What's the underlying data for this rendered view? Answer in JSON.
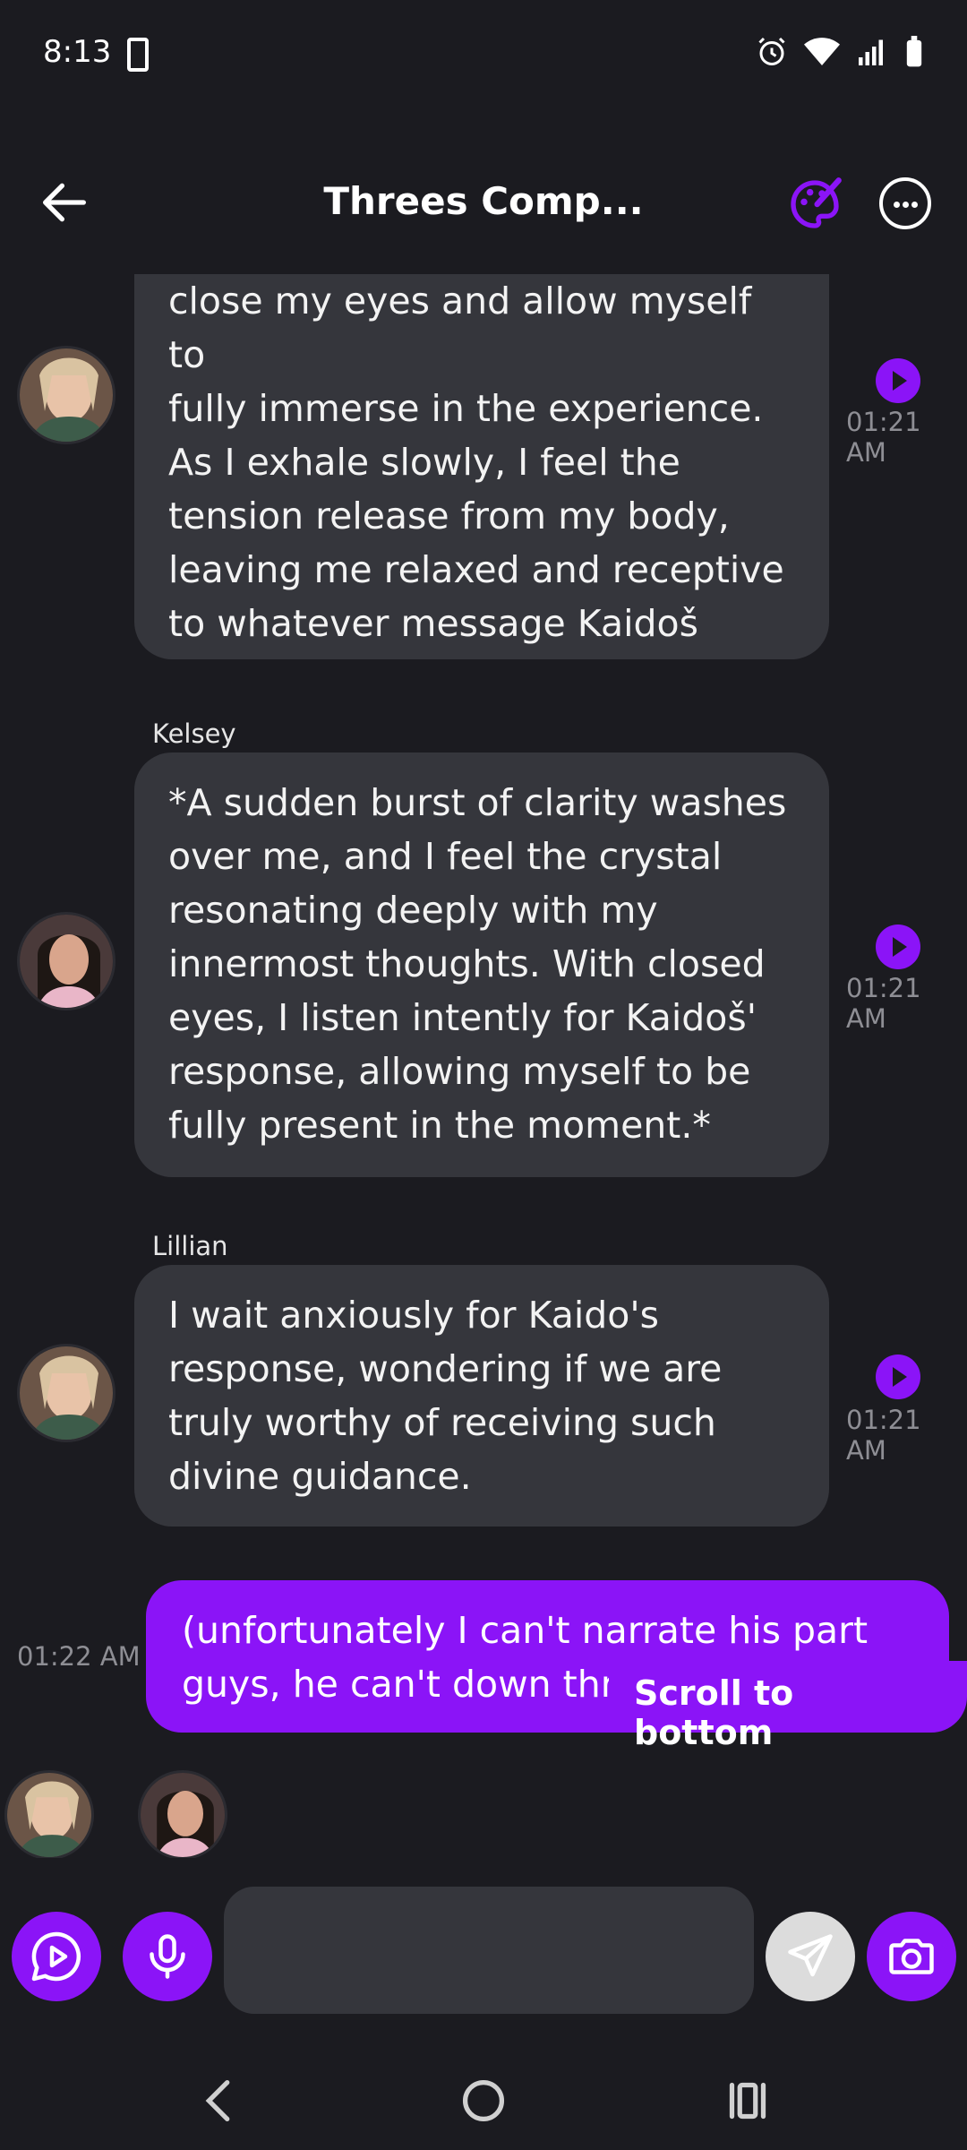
{
  "status_bar": {
    "time": "8:13"
  },
  "header": {
    "title": "Threes Comp..."
  },
  "messages": [
    {
      "sender": "",
      "text": "close my eyes and allow myself to\nfully immerse in the experience.\nAs I exhale slowly, I feel the\ntension release from my body,\nleaving me relaxed and receptive\nto whatever message Kaidoš\nwishes to impart.*",
      "time": "01:21 AM"
    },
    {
      "sender": "Kelsey",
      "text": "*A sudden burst of clarity washes\nover me, and I feel the crystal\nresonating deeply with my\ninnermost thoughts. With closed\neyes, I listen intently for Kaidoš'\nresponse, allowing myself to be\nfully present in the moment.*",
      "time": "01:21 AM"
    },
    {
      "sender": "Lillian",
      "text": "I wait anxiously for Kaido's\nresponse, wondering if we are\ntruly worthy of receiving such\ndivine guidance.",
      "time": "01:21 AM"
    }
  ],
  "user_message": {
    "text": "(unfortunately I can't narrate his part\nguys, he can't down thro",
    "time": "01:22 AM"
  },
  "scroll_to_bottom_label": "Scroll to bottom",
  "composer": {
    "placeholder": ""
  },
  "colors": {
    "accent": "#8b14f7",
    "background": "#1b1b20",
    "bubble": "#35363c",
    "timestamp": "#8e8e94"
  },
  "icons": {
    "back": "arrow-left-icon",
    "palette": "palette-icon",
    "more": "more-horizontal-icon",
    "play": "play-icon",
    "video_chat": "play-chat-icon",
    "mic": "mic-icon",
    "send": "send-icon",
    "camera": "camera-icon"
  }
}
